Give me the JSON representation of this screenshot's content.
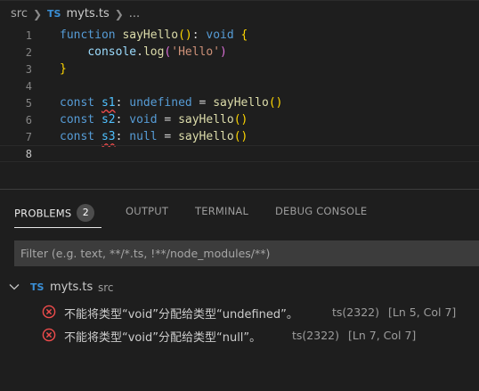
{
  "breadcrumb": {
    "folder": "src",
    "ts_badge": "TS",
    "file": "myts.ts",
    "more": "..."
  },
  "editor": {
    "lines": [
      {
        "num": "1",
        "tokens": [
          [
            "kw",
            "function"
          ],
          [
            "plain",
            " "
          ],
          [
            "fn",
            "sayHello"
          ],
          [
            "paren",
            "()"
          ],
          [
            "plain",
            ": "
          ],
          [
            "kw",
            "void"
          ],
          [
            "plain",
            " "
          ],
          [
            "paren",
            "{"
          ]
        ]
      },
      {
        "num": "2",
        "tokens": [
          [
            "plain",
            "    "
          ],
          [
            "obj",
            "console"
          ],
          [
            "plain",
            "."
          ],
          [
            "fn",
            "log"
          ],
          [
            "paren2",
            "("
          ],
          [
            "str",
            "'Hello'"
          ],
          [
            "paren2",
            ")"
          ]
        ]
      },
      {
        "num": "3",
        "tokens": [
          [
            "paren",
            "}"
          ]
        ]
      },
      {
        "num": "4",
        "tokens": []
      },
      {
        "num": "5",
        "tokens": [
          [
            "kw",
            "const"
          ],
          [
            "plain",
            " "
          ],
          [
            "var_sq",
            "s1"
          ],
          [
            "plain",
            ": "
          ],
          [
            "kw",
            "undefined"
          ],
          [
            "plain",
            " = "
          ],
          [
            "fn",
            "sayHello"
          ],
          [
            "paren",
            "()"
          ]
        ]
      },
      {
        "num": "6",
        "tokens": [
          [
            "kw",
            "const"
          ],
          [
            "plain",
            " "
          ],
          [
            "var",
            "s2"
          ],
          [
            "plain",
            ": "
          ],
          [
            "kw",
            "void"
          ],
          [
            "plain",
            " = "
          ],
          [
            "fn",
            "sayHello"
          ],
          [
            "paren",
            "()"
          ]
        ]
      },
      {
        "num": "7",
        "tokens": [
          [
            "kw",
            "const"
          ],
          [
            "plain",
            " "
          ],
          [
            "var_sq",
            "s3"
          ],
          [
            "plain",
            ": "
          ],
          [
            "kw",
            "null"
          ],
          [
            "plain",
            " = "
          ],
          [
            "fn",
            "sayHello"
          ],
          [
            "paren",
            "()"
          ]
        ]
      },
      {
        "num": "8",
        "tokens": []
      }
    ],
    "current_line": 8
  },
  "panel": {
    "tabs": [
      {
        "label": "PROBLEMS",
        "badge": "2",
        "active": true
      },
      {
        "label": "OUTPUT"
      },
      {
        "label": "TERMINAL"
      },
      {
        "label": "DEBUG CONSOLE"
      }
    ],
    "filter_placeholder": "Filter (e.g. text, **/*.ts, !**/node_modules/**)",
    "file_group": {
      "ts_badge": "TS",
      "file": "myts.ts",
      "dir": "src"
    },
    "problems": [
      {
        "message": "不能将类型“void”分配给类型“undefined”。",
        "code": "ts(2322)",
        "position": "[Ln 5, Col 7]"
      },
      {
        "message": "不能将类型“void”分配给类型“null”。",
        "code": "ts(2322)",
        "position": "[Ln 7, Col 7]"
      }
    ]
  },
  "colors": {
    "error": "#f14c4c",
    "ts_blue": "#3a8fd6",
    "background": "#1e1e1e"
  }
}
